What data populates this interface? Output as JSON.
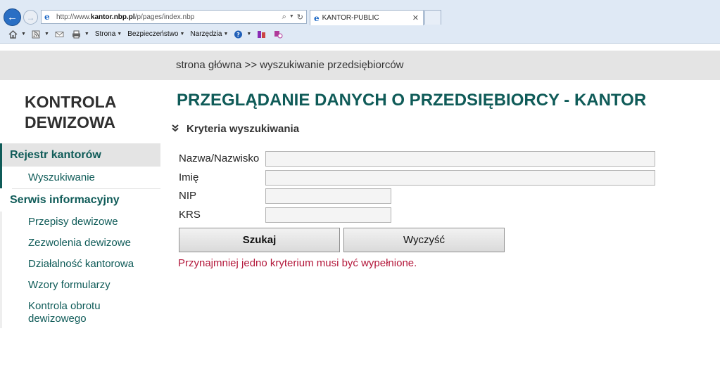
{
  "browser": {
    "url_prefix": "http://www.",
    "url_domain": "kantor.nbp.pl",
    "url_path": "/p/pages/index.nbp",
    "tab_title": "KANTOR-PUBLIC",
    "menus": {
      "page": "Strona",
      "security": "Bezpieczeństwo",
      "tools": "Narzędzia"
    }
  },
  "breadcrumb": "strona główna >> wyszukiwanie przedsiębiorców",
  "sidebar": {
    "title_line1": "KONTROLA",
    "title_line2": "DEWIZOWA",
    "sections": [
      {
        "label": "Rejestr kantorów",
        "items": [
          "Wyszukiwanie"
        ]
      },
      {
        "label": "Serwis informacyjny",
        "items": [
          "Przepisy dewizowe",
          "Zezwolenia dewizowe",
          "Działalność kantorowa",
          "Wzory formularzy",
          "Kontrola obrotu",
          "dewizowego"
        ]
      }
    ]
  },
  "main": {
    "title": "PRZEGLĄDANIE DANYCH O PRZEDSIĘBIORCY - KANTOR",
    "criteria_label": "Kryteria wyszukiwania",
    "fields": [
      {
        "label": "Nazwa/Nazwisko",
        "value": ""
      },
      {
        "label": "Imię",
        "value": ""
      },
      {
        "label": "NIP",
        "value": ""
      },
      {
        "label": "KRS",
        "value": ""
      }
    ],
    "search_button": "Szukaj",
    "clear_button": "Wyczyść",
    "error_message": "Przynajmniej jedno kryterium musi być wypełnione."
  },
  "colors": {
    "accent": "#0f5b58",
    "error": "#b3173a",
    "band": "#e4e4e4"
  },
  "icons": [
    "back-arrow-icon",
    "forward-arrow-icon",
    "ie-logo-icon",
    "search-icon",
    "refresh-icon",
    "close-icon",
    "home-icon",
    "rss-icon",
    "mail-icon",
    "print-icon",
    "help-icon",
    "research-icon",
    "translate-icon",
    "chevron-double-down-icon"
  ]
}
